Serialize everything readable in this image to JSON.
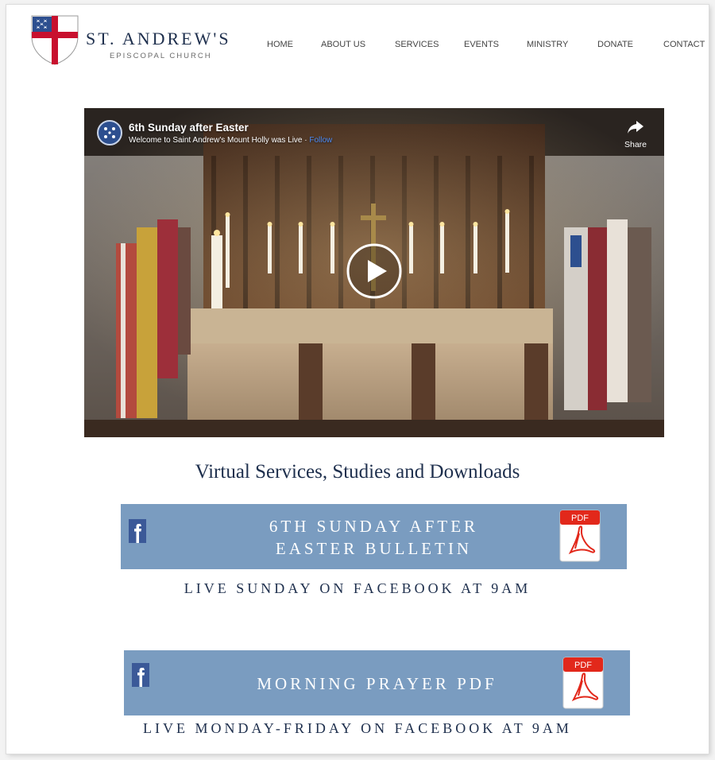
{
  "header": {
    "brand_name": "ST. ANDREW'S",
    "brand_sub": "EPISCOPAL CHURCH",
    "nav": [
      "HOME",
      "ABOUT US",
      "SERVICES",
      "EVENTS",
      "MINISTRY",
      "DONATE",
      "CONTACT"
    ]
  },
  "video": {
    "title": "6th Sunday after Easter",
    "subtitle": "Welcome to Saint Andrew's Mount Holly was Live · ",
    "follow_label": "Follow",
    "share_label": "Share"
  },
  "downloads": {
    "heading": "Virtual Services, Studies and Downloads",
    "cards": [
      {
        "title_line1": "6TH SUNDAY AFTER",
        "title_line2": "EASTER BULLETIN",
        "pdf_badge": "PDF",
        "caption": "LIVE SUNDAY ON FACEBOOK AT 9AM"
      },
      {
        "title": "MORNING PRAYER PDF",
        "pdf_badge": "PDF",
        "caption": "LIVE MONDAY-FRIDAY ON FACEBOOK AT 9AM"
      }
    ]
  },
  "colors": {
    "navy": "#1e2f4d",
    "card_blue": "#7a9cc0",
    "facebook_blue": "#3b5998",
    "pdf_red": "#e2281b",
    "shield_red": "#c8102e"
  }
}
